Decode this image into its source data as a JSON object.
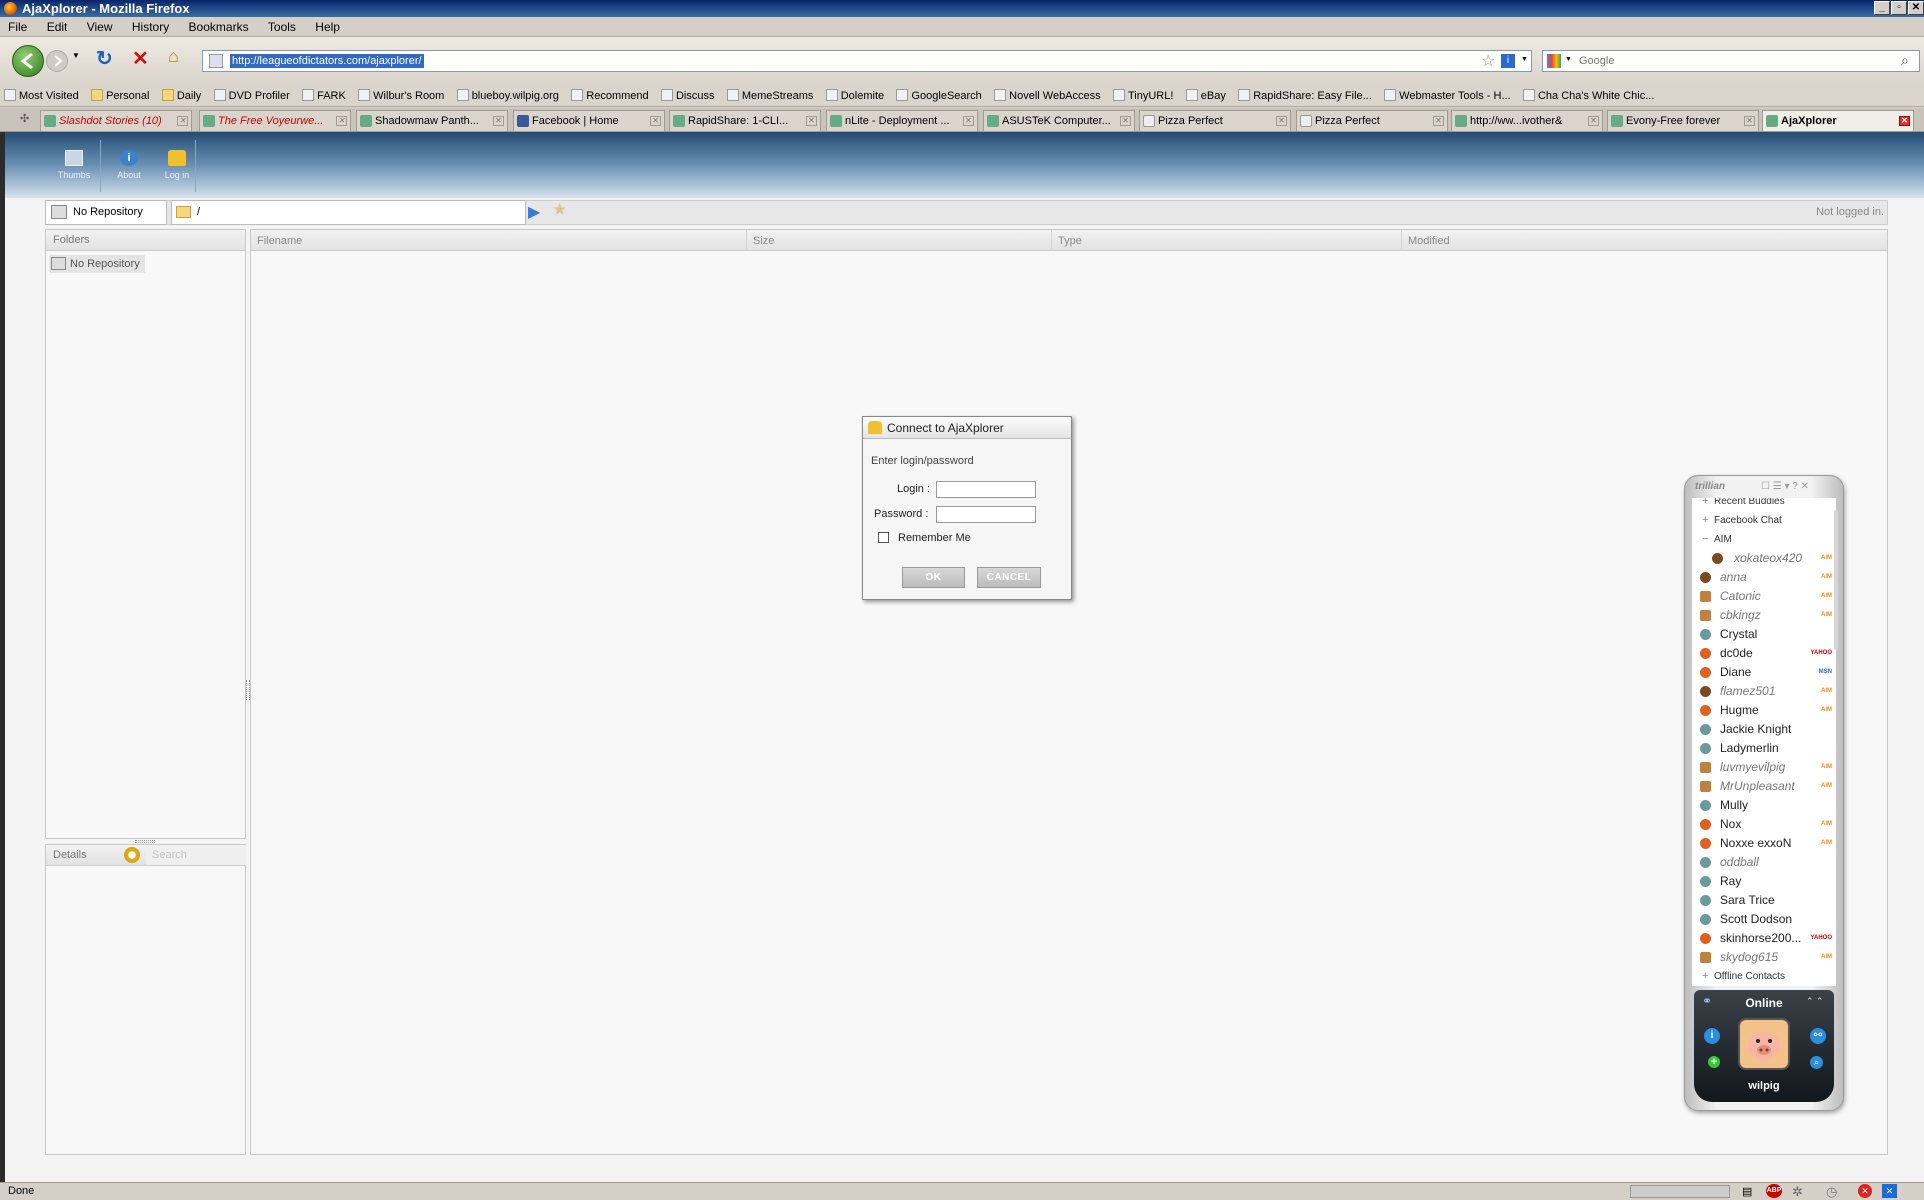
{
  "window": {
    "title": "AjaXplorer - Mozilla Firefox"
  },
  "menu": [
    "File",
    "Edit",
    "View",
    "History",
    "Bookmarks",
    "Tools",
    "Help"
  ],
  "nav": {
    "url": "http://leagueofdictators.com/ajaxplorer/",
    "search_placeholder": "Google"
  },
  "bookmarks": [
    "Most Visited",
    "Personal",
    "Daily",
    "DVD Profiler",
    "FARK",
    "Wilbur's Room",
    "blueboy.wilpig.org",
    "Recommend",
    "Discuss",
    "MemeStreams",
    "Dolemite",
    "GoogleSearch",
    "Novell WebAccess",
    "TinyURL!",
    "eBay",
    "RapidShare: Easy File...",
    "Webmaster Tools - H...",
    "Cha Cha's White Chic..."
  ],
  "tabs": [
    {
      "label": "Slashdot Stories (10)"
    },
    {
      "label": "The Free Voyeurwe..."
    },
    {
      "label": "Shadowmaw Panth..."
    },
    {
      "label": "Facebook | Home"
    },
    {
      "label": "RapidShare: 1-CLI..."
    },
    {
      "label": "nLite - Deployment ..."
    },
    {
      "label": "ASUSTeK Computer..."
    },
    {
      "label": "Pizza Perfect"
    },
    {
      "label": "Pizza Perfect"
    },
    {
      "label": "http://ww...ivother&"
    },
    {
      "label": "Evony-Free forever"
    },
    {
      "label": "AjaXplorer"
    }
  ],
  "app": {
    "toolbar": {
      "thumbs": "Thumbs",
      "about": "About",
      "login": "Log in"
    },
    "repository": "No Repository",
    "path": "/",
    "login_status": "Not logged in.",
    "folders_header": "Folders",
    "folder_item": "No Repository",
    "details_header": "Details",
    "search_placeholder": "Search",
    "columns": [
      "Filename",
      "Size",
      "Type",
      "Modified"
    ]
  },
  "dialog": {
    "title": "Connect to AjaXplorer",
    "prompt": "Enter login/password",
    "login_label": "Login :",
    "password_label": "Password :",
    "remember_label": "Remember Me",
    "ok": "OK",
    "cancel": "CANCEL"
  },
  "trillian": {
    "brand": "trillian",
    "groups": {
      "recent": "Recent Buddies",
      "facebook": "Facebook Chat",
      "aim": "AIM",
      "offline": "Offline Contacts"
    },
    "buddies": [
      {
        "name": "xokateox420",
        "network": "AIM",
        "status": "away"
      },
      {
        "name": "anna",
        "network": "AIM",
        "status": "away"
      },
      {
        "name": "Catonic",
        "network": "AIM",
        "status": "brb"
      },
      {
        "name": "cbkingz",
        "network": "AIM",
        "status": "brb"
      },
      {
        "name": "Crystal",
        "network": "",
        "status": "mobile"
      },
      {
        "name": "dc0de",
        "network": "YAHOO",
        "status": "online"
      },
      {
        "name": "Diane",
        "network": "MSN",
        "status": "online"
      },
      {
        "name": "flamez501",
        "network": "AIM",
        "status": "away"
      },
      {
        "name": "Hugme",
        "network": "AIM",
        "status": "online"
      },
      {
        "name": "Jackie Knight",
        "network": "",
        "status": "mobile"
      },
      {
        "name": "Ladymerlin",
        "network": "",
        "status": "mobile"
      },
      {
        "name": "luvmyevilpig",
        "network": "AIM",
        "status": "brb"
      },
      {
        "name": "MrUnpleasant",
        "network": "AIM",
        "status": "brb"
      },
      {
        "name": "Mully",
        "network": "",
        "status": "mobile"
      },
      {
        "name": "Nox",
        "network": "AIM",
        "status": "online"
      },
      {
        "name": "Noxxe exxoN",
        "network": "AIM",
        "status": "online"
      },
      {
        "name": "oddball",
        "network": "",
        "status": "mobile"
      },
      {
        "name": "Ray",
        "network": "",
        "status": "mobile"
      },
      {
        "name": "Sara Trice",
        "network": "",
        "status": "mobile"
      },
      {
        "name": "Scott Dodson",
        "network": "",
        "status": "mobile"
      },
      {
        "name": "skinhorse200...",
        "network": "YAHOO",
        "status": "online"
      },
      {
        "name": "skydog615",
        "network": "AIM",
        "status": "brb"
      }
    ],
    "status": "Online",
    "user": "wilpig"
  },
  "statusbar": {
    "text": "Done"
  }
}
